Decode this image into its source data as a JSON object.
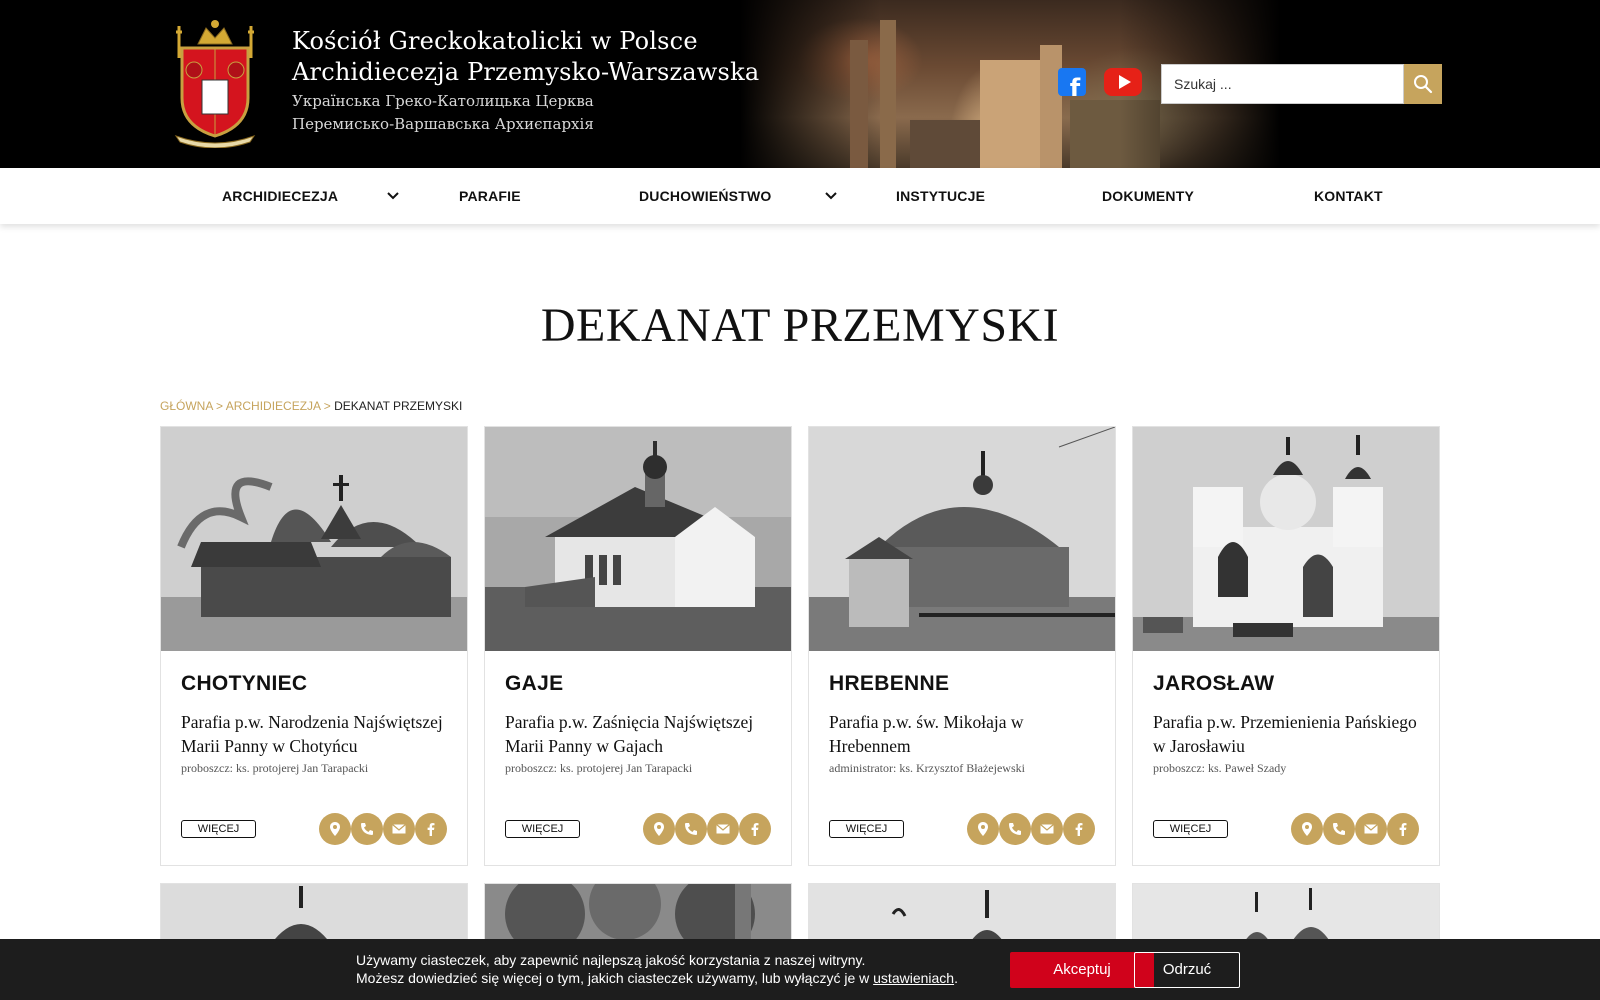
{
  "header": {
    "title_line1": "Kościół Greckokatolicki w Polsce",
    "title_line2": "Archidiecezja Przemysko-Warszawska",
    "subtitle_line1": "Українська Греко-Католицька Церква",
    "subtitle_line2": "Перемисько-Варшавська Архиєпархія",
    "social": {
      "facebook_icon": "facebook-icon",
      "youtube_icon": "youtube-icon"
    },
    "search": {
      "placeholder": "Szukaj ..."
    }
  },
  "nav": {
    "items": [
      {
        "label": "ARCHIDIECEZJA",
        "has_submenu": true
      },
      {
        "label": "PARAFIE",
        "has_submenu": false
      },
      {
        "label": "DUCHOWIEŃSTWO",
        "has_submenu": true
      },
      {
        "label": "INSTYTUCJE",
        "has_submenu": false
      },
      {
        "label": "DOKUMENTY",
        "has_submenu": false
      },
      {
        "label": "KONTAKT",
        "has_submenu": false
      }
    ]
  },
  "page": {
    "title": "DEKANAT PRZEMYSKI",
    "breadcrumb": {
      "home": "GŁÓWNA",
      "sep": ">",
      "parent": "ARCHIDIECEZJA",
      "current": "DEKANAT PRZEMYSKI"
    }
  },
  "parishes": [
    {
      "name": "CHOTYNIEC",
      "desc": "Parafia p.w. Narodzenia Najświętszej Marii Panny w Chotyńcu",
      "role": "proboszcz: ks. protojerej Jan Tarapacki",
      "more": "WIĘCEJ"
    },
    {
      "name": "GAJE",
      "desc": "Parafia p.w. Zaśnięcia Najświętszej Marii Panny w Gajach",
      "role": "proboszcz: ks. protojerej Jan Tarapacki",
      "more": "WIĘCEJ"
    },
    {
      "name": "HREBENNE",
      "desc": "Parafia p.w. św. Mikołaja w Hrebennem",
      "role": "administrator: ks. Krzysztof Błażejewski",
      "more": "WIĘCEJ"
    },
    {
      "name": "JAROSŁAW",
      "desc": "Parafia p.w. Przemienienia Pańskiego w Jarosławiu",
      "role": "proboszcz: ks. Paweł Szady",
      "more": "WIĘCEJ"
    }
  ],
  "card_icons": [
    "map-pin-icon",
    "phone-icon",
    "mail-icon",
    "facebook-icon"
  ],
  "colors": {
    "accent": "#c6a45d",
    "accept": "#d0021b",
    "cookie_bg": "#1d1d1d"
  },
  "cookie": {
    "line1": "Używamy ciasteczek, aby zapewnić najlepszą jakość korzystania z naszej witryny.",
    "line2_prefix": "Możesz dowiedzieć się więcej o tym, jakich ciasteczek używamy, lub wyłączyć je w",
    "settings_link": "ustawieniach",
    "line2_suffix": ".",
    "accept": "Akceptuj",
    "reject": "Odrzuć"
  }
}
